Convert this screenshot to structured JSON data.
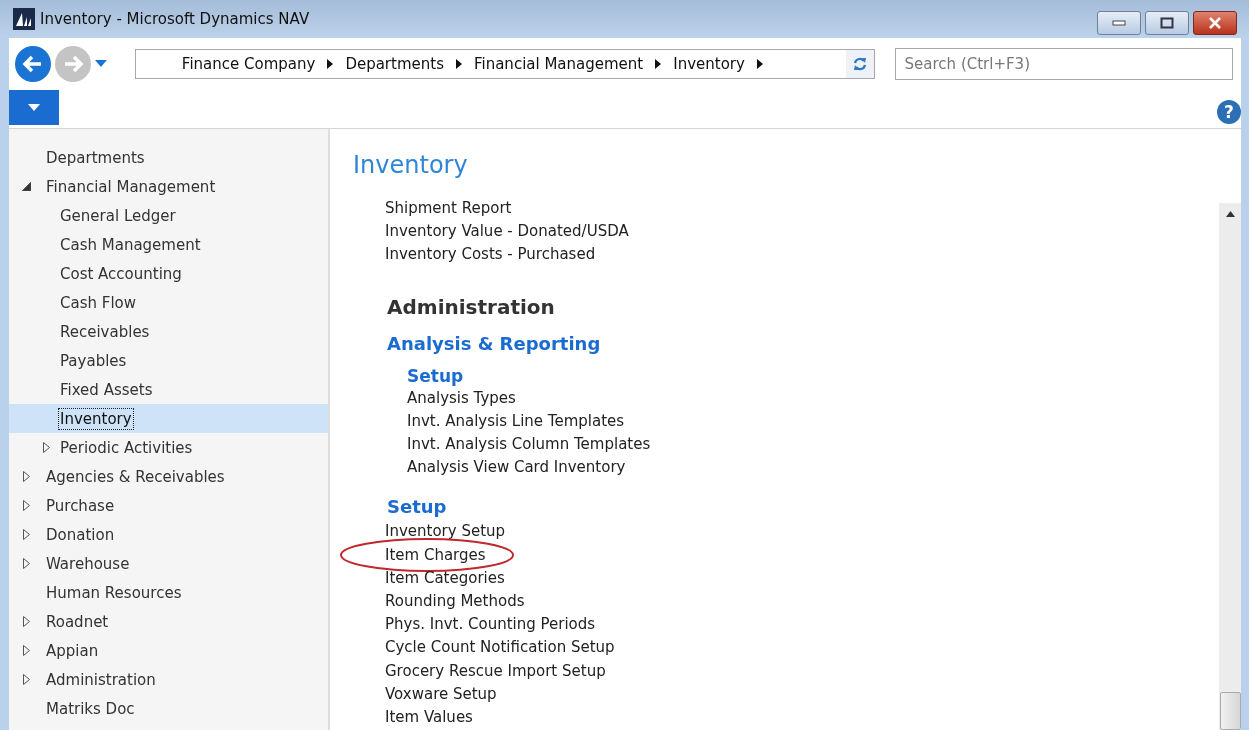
{
  "window": {
    "title": "Inventory - Microsoft Dynamics NAV"
  },
  "address_bar": {
    "crumbs": [
      "Finance Company",
      "Departments",
      "Financial Management",
      "Inventory"
    ]
  },
  "search": {
    "placeholder": "Search (Ctrl+F3)"
  },
  "help": {
    "label": "?"
  },
  "nav_tree": [
    {
      "label": "Departments",
      "selected": false
    },
    {
      "label": "Financial Management",
      "expanded": true,
      "selected": false,
      "children": [
        {
          "label": "General Ledger",
          "selected": false
        },
        {
          "label": "Cash Management",
          "selected": false
        },
        {
          "label": "Cost Accounting",
          "selected": false
        },
        {
          "label": "Cash Flow",
          "selected": false
        },
        {
          "label": "Receivables",
          "selected": false
        },
        {
          "label": "Payables",
          "selected": false
        },
        {
          "label": "Fixed Assets",
          "selected": false
        },
        {
          "label": "Inventory",
          "selected": true
        },
        {
          "label": "Periodic Activities",
          "expanded": false,
          "selected": false
        }
      ]
    },
    {
      "label": "Agencies & Receivables",
      "expanded": false,
      "selected": false
    },
    {
      "label": "Purchase",
      "expanded": false,
      "selected": false
    },
    {
      "label": "Donation",
      "expanded": false,
      "selected": false
    },
    {
      "label": "Warehouse",
      "expanded": false,
      "selected": false
    },
    {
      "label": "Human Resources",
      "selected": false
    },
    {
      "label": "Roadnet",
      "expanded": false,
      "selected": false
    },
    {
      "label": "Appian",
      "expanded": false,
      "selected": false
    },
    {
      "label": "Administration",
      "expanded": false,
      "selected": false
    },
    {
      "label": "Matriks Doc",
      "selected": false
    }
  ],
  "content": {
    "title": "Inventory",
    "lead_items": [
      "Shipment Report",
      "Inventory Value - Donated/USDA",
      "Inventory Costs - Purchased"
    ],
    "sections": [
      {
        "heading": "Administration",
        "groups": [
          {
            "title": "Analysis & Reporting",
            "subgroups": [
              {
                "title": "Setup",
                "items": [
                  {
                    "label": "Analysis Types",
                    "circled": false
                  },
                  {
                    "label": "Invt. Analysis Line Templates",
                    "circled": false
                  },
                  {
                    "label": "Invt. Analysis Column Templates",
                    "circled": false
                  },
                  {
                    "label": "Analysis View Card Inventory",
                    "circled": false
                  }
                ]
              }
            ]
          },
          {
            "title": "Setup",
            "items": [
              {
                "label": "Inventory Setup",
                "circled": false
              },
              {
                "label": "Item Charges",
                "circled": true
              },
              {
                "label": "Item Categories",
                "circled": false
              },
              {
                "label": "Rounding Methods",
                "circled": false
              },
              {
                "label": "Phys. Invt. Counting Periods",
                "circled": false
              },
              {
                "label": "Cycle Count Notification Setup",
                "circled": false
              },
              {
                "label": "Grocery Rescue Import Setup",
                "circled": false
              },
              {
                "label": "Voxware Setup",
                "circled": false
              },
              {
                "label": "Item Values",
                "circled": false
              }
            ]
          }
        ]
      }
    ]
  }
}
